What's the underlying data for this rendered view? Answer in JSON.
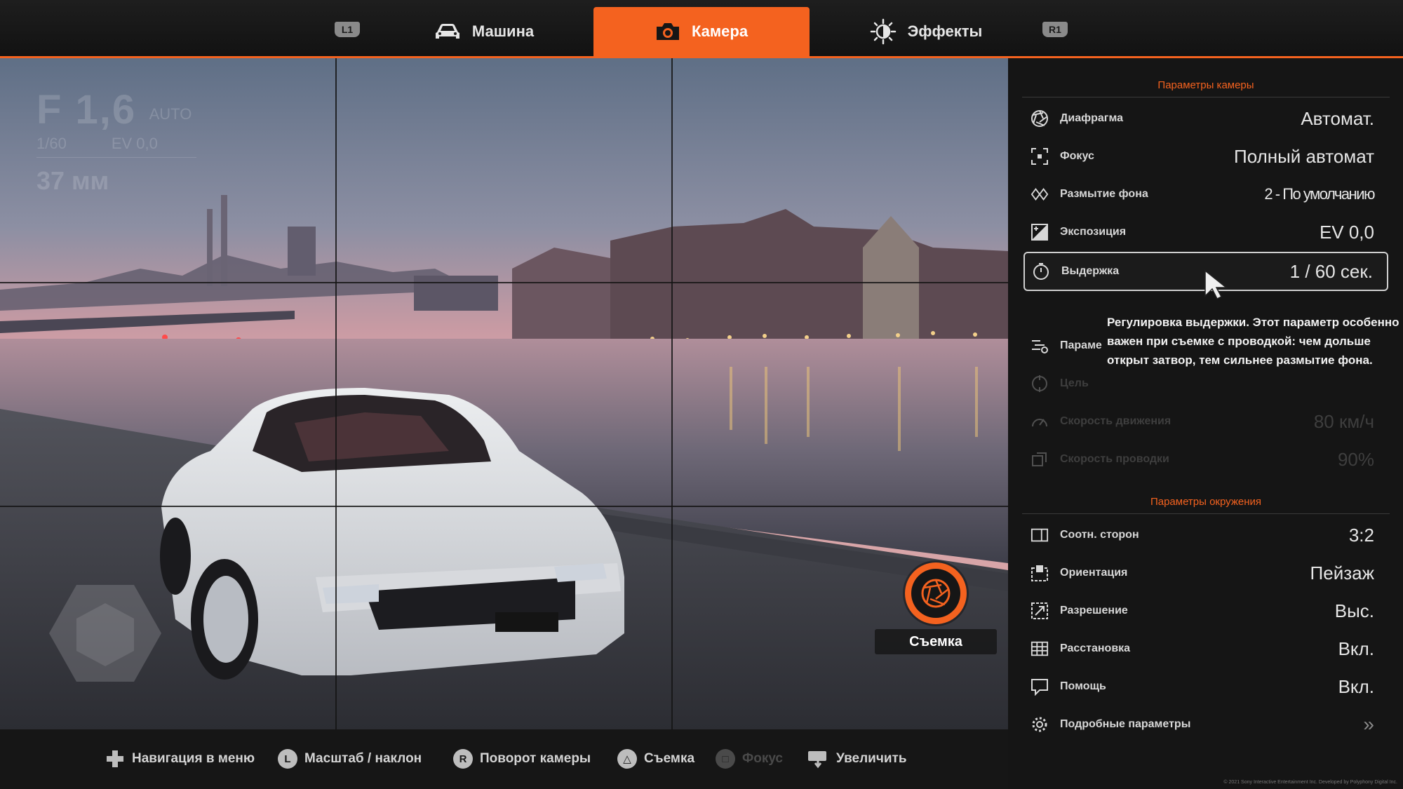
{
  "topbar": {
    "l1": "L1",
    "r1": "R1",
    "tabs": [
      {
        "label": "Машина",
        "icon": "car-icon",
        "active": false
      },
      {
        "label": "Камера",
        "icon": "camera-icon",
        "active": true
      },
      {
        "label": "Эффекты",
        "icon": "brightness-icon",
        "active": false
      }
    ]
  },
  "overlay": {
    "aperture": "F 1,6",
    "aperture_mode": "AUTO",
    "shutter": "1/60",
    "ev": "EV 0,0",
    "focal": "37 мм"
  },
  "shutter_button": {
    "label": "Съемка",
    "icon": "shutter-icon"
  },
  "panel": {
    "camera_title": "Параметры камеры",
    "camera_rows": [
      {
        "label": "Диафрагма",
        "value": "Автомат.",
        "icon": "aperture-icon"
      },
      {
        "label": "Фокус",
        "value": "Полный автомат",
        "icon": "focus-icon"
      },
      {
        "label": "Размытие фона",
        "value": "2 - По умолчанию",
        "icon": "bokeh-icon"
      },
      {
        "label": "Экспозиция",
        "value": "EV 0,0",
        "icon": "exposure-icon"
      },
      {
        "label": "Выдержка",
        "value": "1 / 60 сек.",
        "icon": "timer-icon"
      }
    ],
    "panning_rows": [
      {
        "label": "Параме",
        "value": "",
        "icon": "panning-icon"
      },
      {
        "label": "Цель",
        "value": "",
        "icon": "target-icon"
      },
      {
        "label": "Скорость движения",
        "value": "80 км/ч",
        "icon": "speed-icon"
      },
      {
        "label": "Скорость проводки",
        "value": "90%",
        "icon": "pan-speed-icon"
      }
    ],
    "env_title": "Параметры окружения",
    "env_rows": [
      {
        "label": "Соотн. сторон",
        "value": "3:2",
        "icon": "aspect-icon"
      },
      {
        "label": "Ориентация",
        "value": "Пейзаж",
        "icon": "orientation-icon"
      },
      {
        "label": "Разрешение",
        "value": "Выс.",
        "icon": "resolution-icon"
      },
      {
        "label": "Расстановка",
        "value": "Вкл.",
        "icon": "grid-icon"
      },
      {
        "label": "Помощь",
        "value": "Вкл.",
        "icon": "help-icon"
      },
      {
        "label": "Подробные параметры",
        "value": "»",
        "icon": "gear-icon"
      }
    ],
    "tooltip": "Регулировка выдержки. Этот параметр особенно важен при съемке с проводкой: чем дольше открыт затвор, тем сильнее размытие фона."
  },
  "hints": [
    {
      "label": "Навигация в меню",
      "button": "✚"
    },
    {
      "label": "Масштаб / наклон",
      "button": "L"
    },
    {
      "label": "Поворот камеры",
      "button": "R"
    },
    {
      "label": "Съемка",
      "button": "△"
    },
    {
      "label": "Фокус",
      "button": "□"
    },
    {
      "label": "Увеличить",
      "button": "touchpad"
    }
  ],
  "copyright": "© 2021 Sony Interactive Entertainment Inc. Developed by Polyphony Digital Inc.",
  "colors": {
    "accent": "#f4621f",
    "panel": "#151515",
    "text": "#e6e6e6"
  }
}
